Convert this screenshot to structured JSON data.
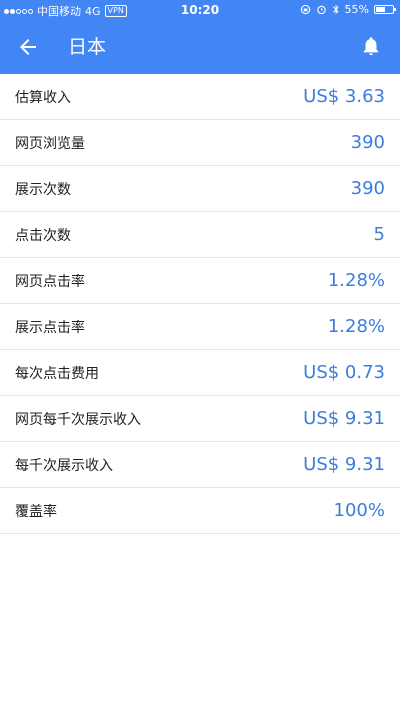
{
  "status_bar": {
    "carrier": "中国移动",
    "network": "4G",
    "vpn": "VPN",
    "time": "10:20",
    "battery": "55%",
    "battery_level": 0.55
  },
  "header": {
    "title": "日本",
    "back_icon": "arrow-back-icon",
    "bell_icon": "bell-icon"
  },
  "rows": [
    {
      "label": "估算收入",
      "value": "US$ 3.63"
    },
    {
      "label": "网页浏览量",
      "value": "390"
    },
    {
      "label": "展示次数",
      "value": "390"
    },
    {
      "label": "点击次数",
      "value": "5"
    },
    {
      "label": "网页点击率",
      "value": "1.28%"
    },
    {
      "label": "展示点击率",
      "value": "1.28%"
    },
    {
      "label": "每次点击费用",
      "value": "US$ 0.73"
    },
    {
      "label": "网页每千次展示收入",
      "value": "US$ 9.31"
    },
    {
      "label": "每千次展示收入",
      "value": "US$ 9.31"
    },
    {
      "label": "覆盖率",
      "value": "100%"
    }
  ],
  "colors": {
    "header_bg": "#4285f4",
    "value_text": "#3b7ddd"
  }
}
